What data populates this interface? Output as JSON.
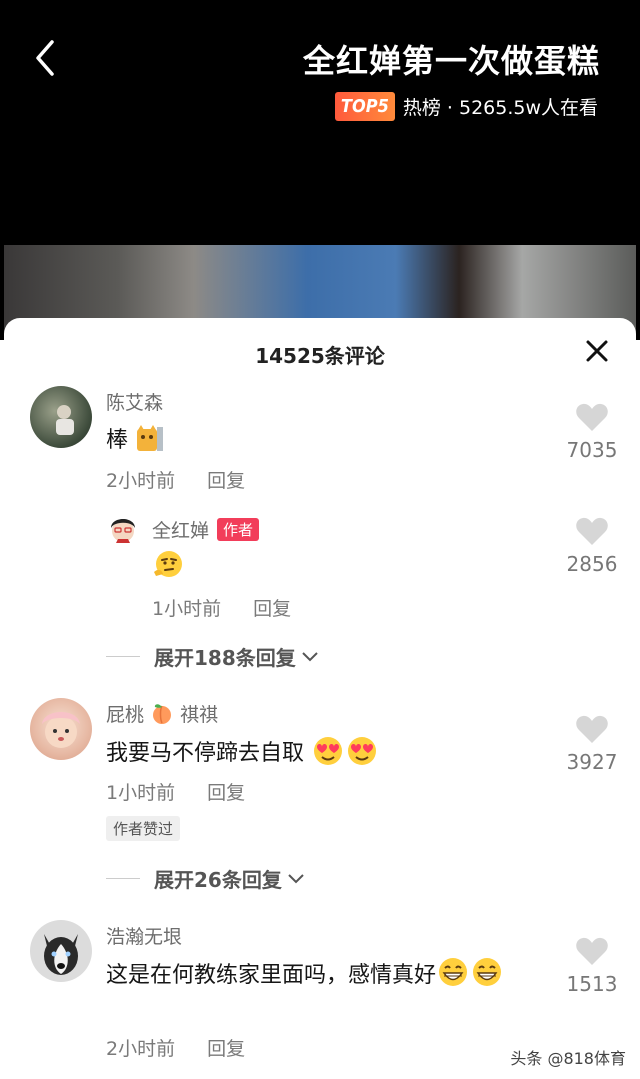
{
  "video": {
    "title": "全红婵第一次做蛋糕",
    "badge": "TOP5",
    "hot_text": "热榜 · 5265.5w人在看"
  },
  "comments_panel": {
    "title": "14525条评论",
    "comments": [
      {
        "author": "陈艾森",
        "text": "棒",
        "time": "2小时前",
        "reply": "回复",
        "likes": "7035"
      },
      {
        "author": "全红婵",
        "author_tag": "作者",
        "text": "",
        "time": "1小时前",
        "reply": "回复",
        "likes": "2856"
      },
      {
        "expand": "展开188条回复"
      },
      {
        "author": "屁桃",
        "author_suffix": "祺祺",
        "text": "我要马不停蹄去自取",
        "time": "1小时前",
        "reply": "回复",
        "likes": "3927",
        "liked_tag": "作者赞过"
      },
      {
        "expand": "展开26条回复"
      },
      {
        "author": "浩瀚无垠",
        "text": "这是在何教练家里面吗，感情真好",
        "time": "2小时前",
        "reply": "回复",
        "likes": "1513"
      }
    ]
  },
  "watermark": "头条 @818体育",
  "colors": {
    "author_tag": "#f23d5a",
    "badge": "#ff6a3c"
  }
}
